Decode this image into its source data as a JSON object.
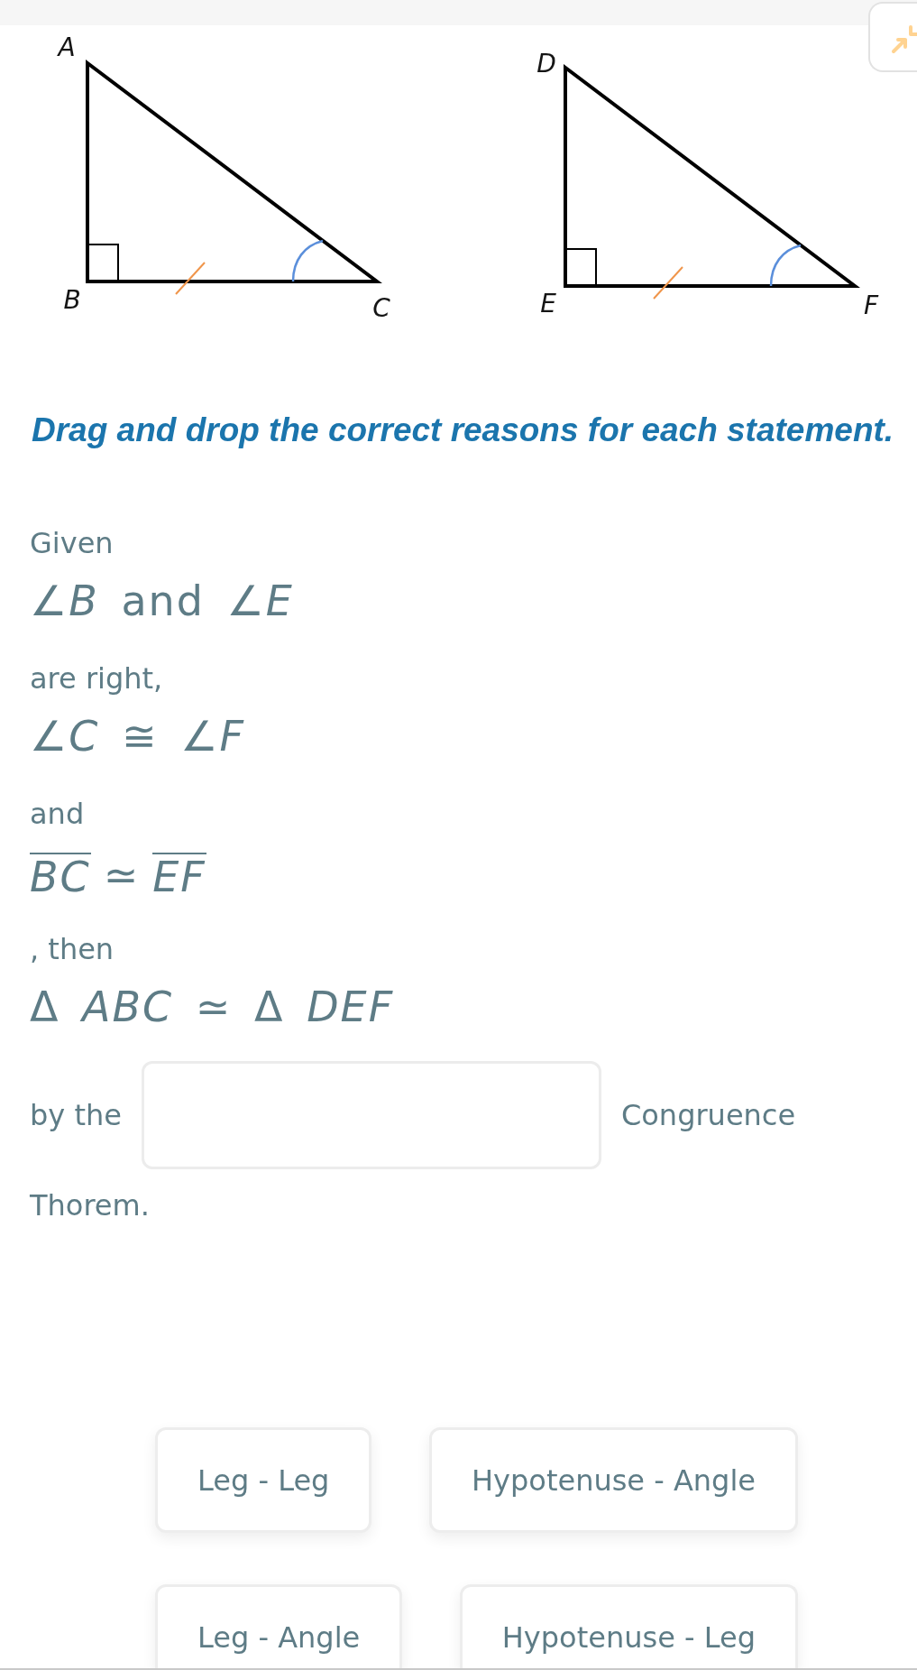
{
  "figures": [
    {
      "vertices": [
        "A",
        "B",
        "C"
      ]
    },
    {
      "vertices": [
        "D",
        "E",
        "F"
      ]
    }
  ],
  "instruction": "Drag and drop the correct reasons for each statement.",
  "statement": [
    {
      "kind": "text",
      "text": "Given"
    },
    {
      "kind": "math",
      "text": "∠*B* and ∠*E*"
    },
    {
      "kind": "text",
      "text": "are right,"
    },
    {
      "kind": "math",
      "text": "∠*C* ≅ ∠*F*"
    },
    {
      "kind": "text",
      "text": "and"
    },
    {
      "kind": "segments",
      "left": "BC",
      "relation": "≃",
      "right": "EF"
    },
    {
      "kind": "text",
      "text": ", then"
    },
    {
      "kind": "math",
      "text": "Δ *ABC* ≃ Δ *DEF*"
    },
    {
      "kind": "blank",
      "before": "by the",
      "after": "Congruence"
    },
    {
      "kind": "text",
      "text": "Thorem."
    }
  ],
  "choices": [
    "Leg - Leg",
    "Hypotenuse - Angle",
    "Leg - Angle",
    "Hypotenuse - Leg"
  ]
}
